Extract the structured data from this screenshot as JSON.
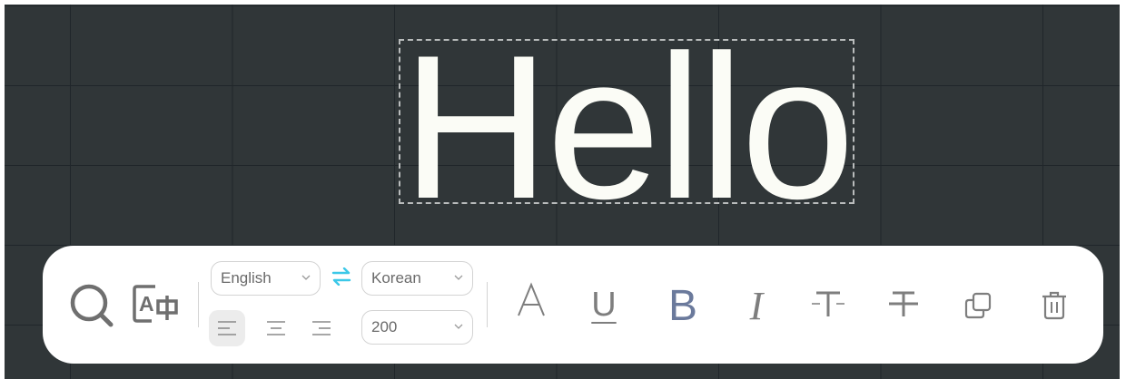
{
  "canvas": {
    "text": "Hello",
    "text_color": "#fbfcf6",
    "background": "#303638"
  },
  "toolbar": {
    "search_icon": "search-icon",
    "translate_icon": "translate-icon",
    "source_language": "English",
    "target_language": "Korean",
    "swap_icon": "swap-arrows-icon",
    "swap_color": "#3cc8e8",
    "font_size": "200",
    "alignments": [
      "align-left",
      "align-center",
      "align-right"
    ],
    "active_alignment": "align-left",
    "font_color_glyph": "A",
    "underline_glyph": "U",
    "bold_glyph": "B",
    "bold_color": "#6b7a9c",
    "italic_glyph": "I",
    "icons": [
      "text-strike-top-icon",
      "strikethrough-icon",
      "duplicate-icon",
      "trash-icon"
    ]
  }
}
